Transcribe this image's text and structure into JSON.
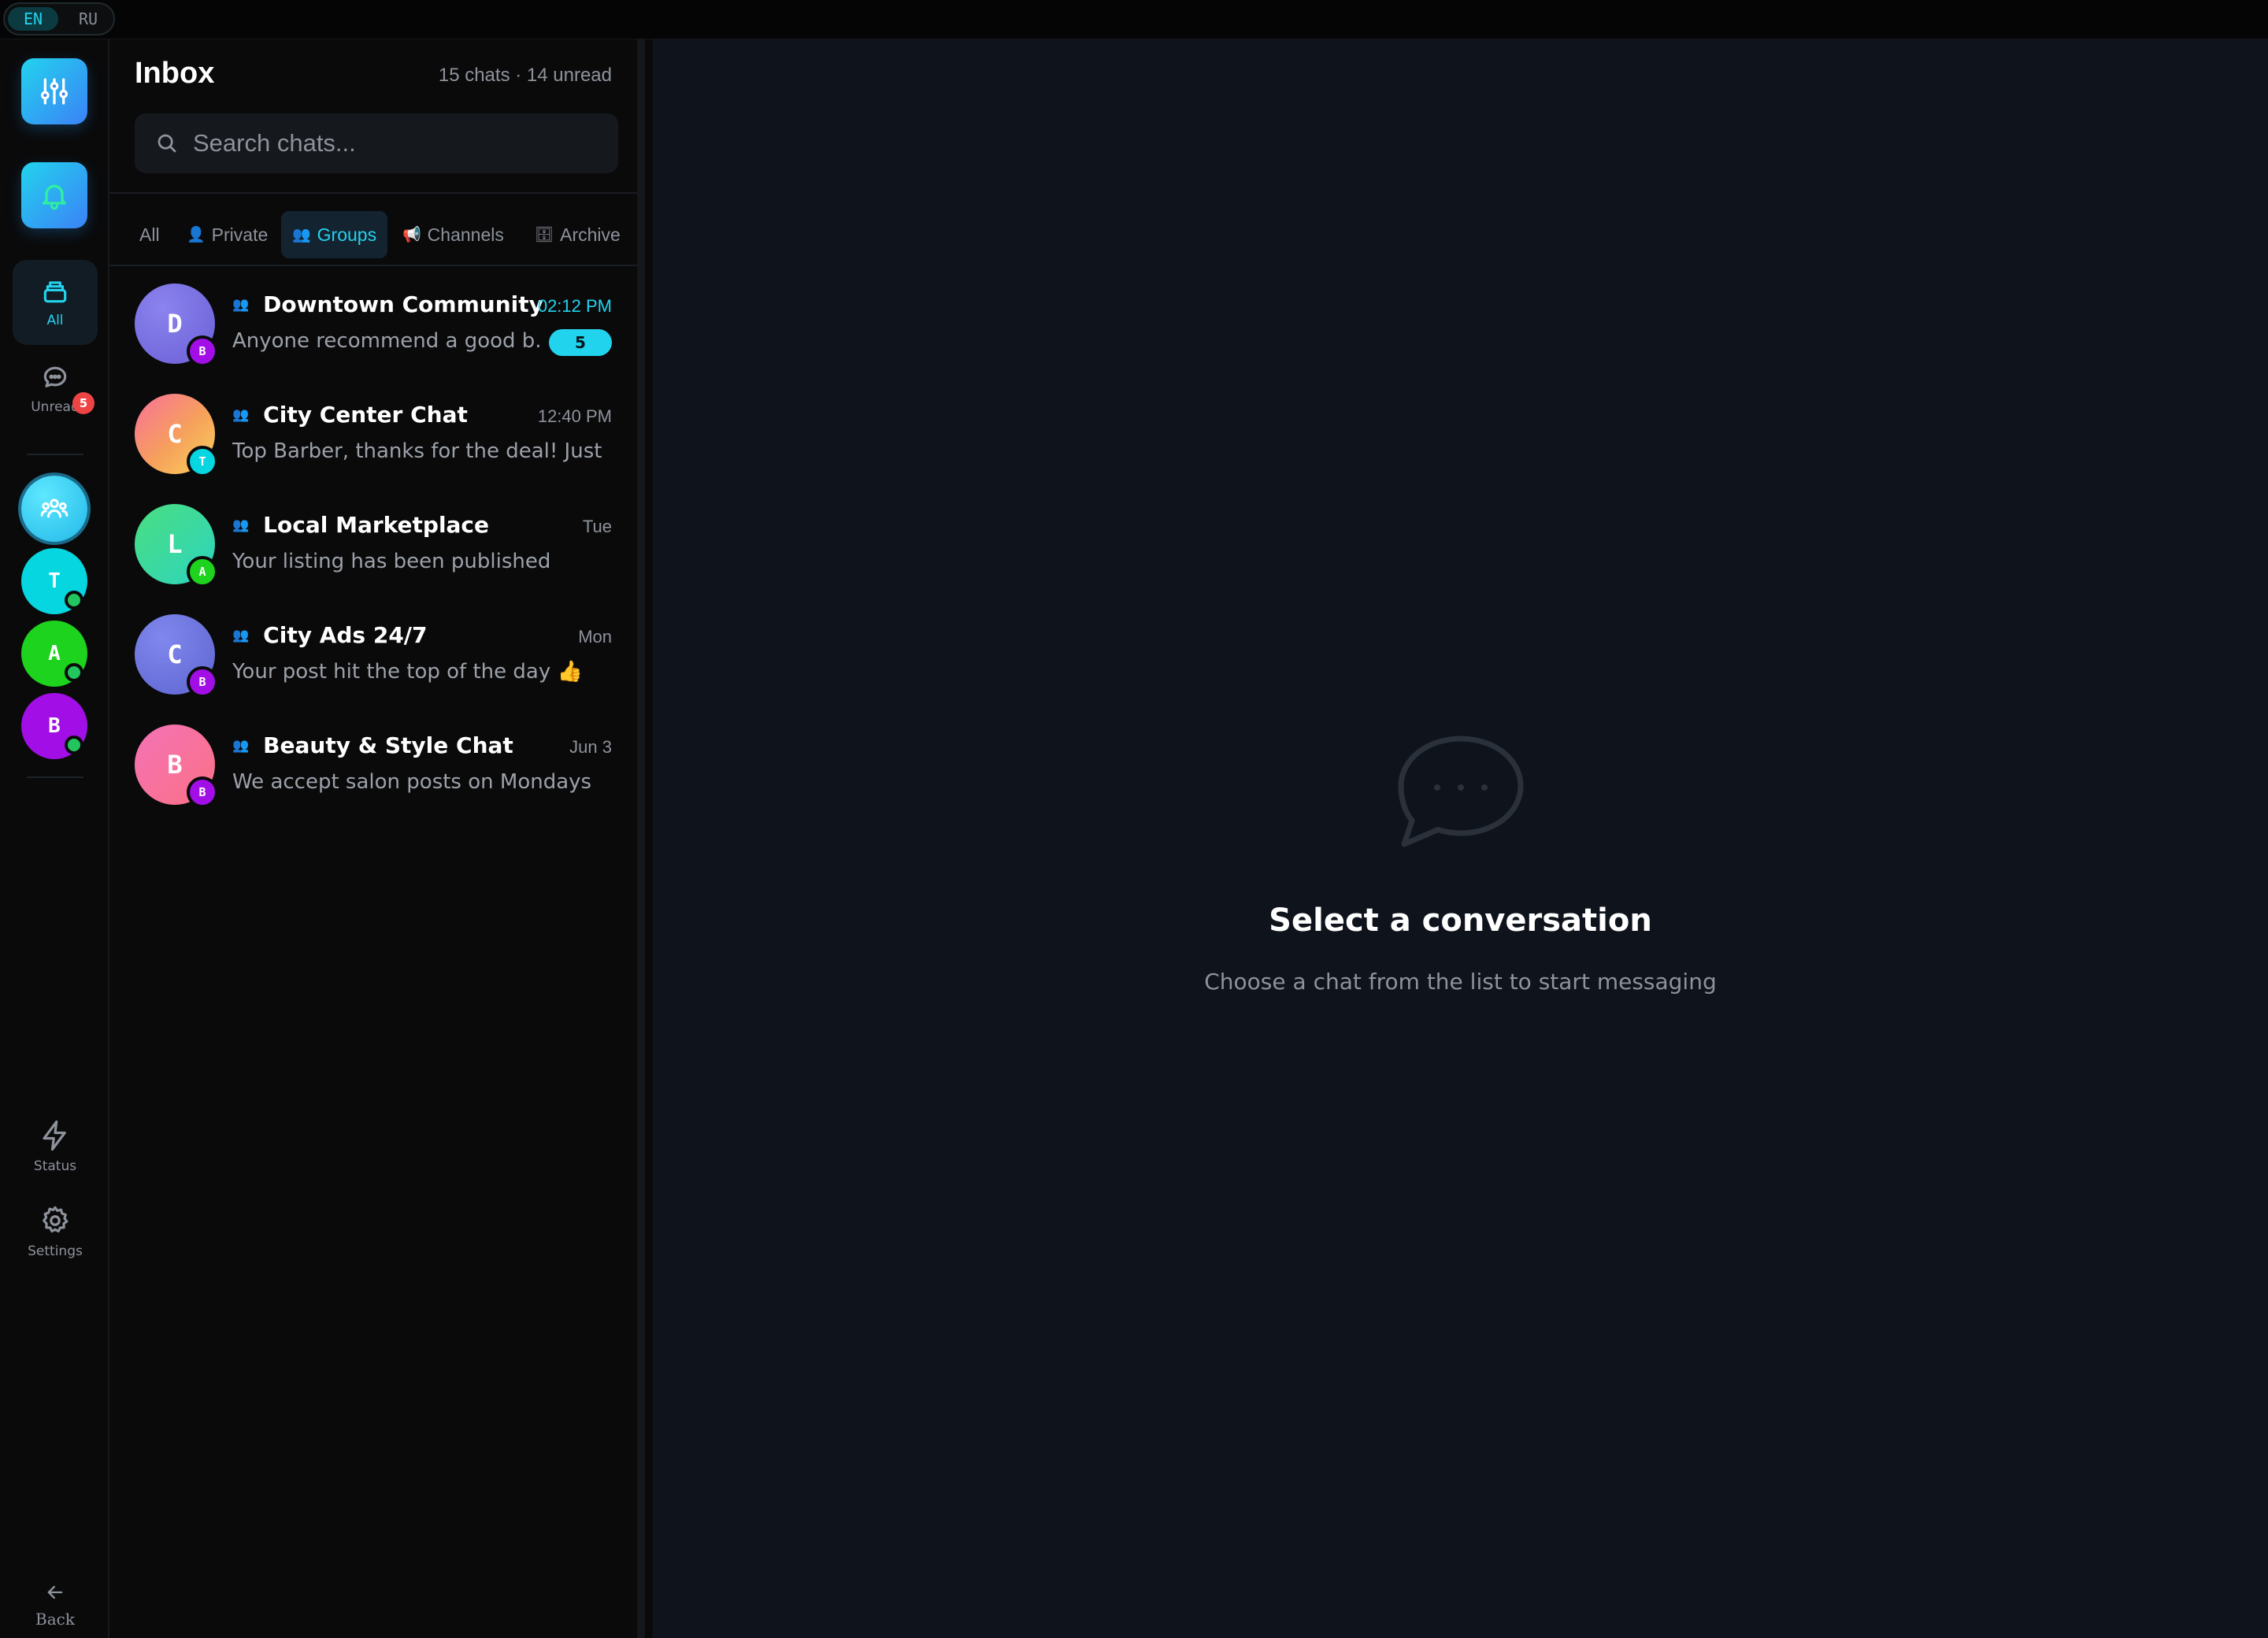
{
  "language": {
    "options": [
      "EN",
      "RU"
    ],
    "selected": "EN"
  },
  "rail": {
    "nav": [
      {
        "label": "All",
        "icon": "inbox-stack-icon",
        "active": true
      },
      {
        "label": "Unread",
        "icon": "chat-bubble-icon",
        "badge": "5"
      }
    ],
    "avatars": [
      {
        "icon": "people-group-icon",
        "color": "#22d3ee"
      },
      {
        "initial": "T",
        "color": "#06d6e0",
        "online": true
      },
      {
        "initial": "A",
        "color": "#1dd31d",
        "online": true
      },
      {
        "initial": "B",
        "color": "#a10ee6",
        "online": true
      }
    ],
    "bottom": [
      {
        "label": "Status",
        "icon": "lightning-icon"
      },
      {
        "label": "Settings",
        "icon": "gear-icon"
      },
      {
        "label": "Back",
        "icon": "arrow-left-icon"
      }
    ]
  },
  "inbox": {
    "title": "Inbox",
    "meta": "15 chats · 14 unread",
    "search_placeholder": "Search chats...",
    "tabs": [
      {
        "label": "All",
        "emoji": ""
      },
      {
        "label": "Private",
        "emoji": "👤"
      },
      {
        "label": "Groups",
        "emoji": "👥",
        "active": true
      },
      {
        "label": "Channels",
        "emoji": "📢"
      },
      {
        "label": "Archive",
        "emoji": "🗄"
      }
    ],
    "chats": [
      {
        "initial": "D",
        "badge": "B",
        "name": "Downtown Community",
        "time": "02:12 PM",
        "preview": "Anyone recommend a good b...",
        "unread": "5",
        "color": "#7b6fe0",
        "badge_color": "#a10ee6"
      },
      {
        "initial": "C",
        "badge": "T",
        "name": "City Center Chat",
        "time": "12:40 PM",
        "preview": "Top Barber, thanks for the deal! Just ...",
        "color": "#f6a15b",
        "badge_color": "#06d6e0"
      },
      {
        "initial": "L",
        "badge": "A",
        "name": "Local Marketplace",
        "time": "Tue",
        "preview": "Your listing has been published",
        "color": "#34d399",
        "badge_color": "#1dd31d"
      },
      {
        "initial": "C",
        "badge": "B",
        "name": "City Ads 24/7",
        "time": "Mon",
        "preview": "Your post hit the top of the day 👍",
        "color": "#6b74e0",
        "badge_color": "#a10ee6"
      },
      {
        "initial": "B",
        "badge": "B",
        "name": "Beauty & Style Chat",
        "time": "Jun 3",
        "preview": "We accept salon posts on Mondays",
        "color": "#f472b6",
        "badge_color": "#a10ee6"
      }
    ]
  },
  "empty_state": {
    "icon": "chat-bubble-dots-icon",
    "title": "Select a conversation",
    "subtitle": "Choose a chat from the list to start messaging"
  },
  "colors": {
    "accent": "#22d3ee",
    "main_bg": "#0f141c",
    "rail_bg": "#0a0a0b"
  }
}
